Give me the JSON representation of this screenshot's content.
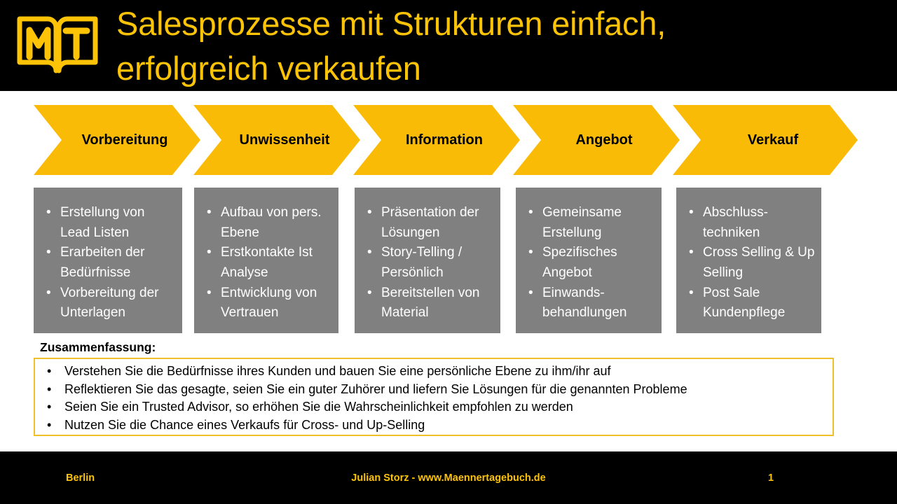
{
  "header": {
    "logo_icon": "open-book-mt-logo",
    "logo_letters": "MT",
    "title": "Salesprozesse mit Strukturen einfach,\nerfolgreich verkaufen"
  },
  "colors": {
    "brand_yellow": "#FABB07",
    "title_gold": "#FDC307",
    "box_gray": "#808080",
    "summary_border": "#EFC028",
    "bar_black": "#000000"
  },
  "process": {
    "steps": [
      {
        "label": "Vorbereitung"
      },
      {
        "label": "Unwissenheit"
      },
      {
        "label": "Information"
      },
      {
        "label": "Angebot"
      },
      {
        "label": "Verkauf"
      }
    ]
  },
  "detail_boxes": [
    {
      "step": "Vorbereitung",
      "items": [
        "Erstellung von Lead Listen",
        "Erarbeiten der Bedürfnisse",
        "Vorbereitung der Unterlagen"
      ]
    },
    {
      "step": "Unwissenheit",
      "items": [
        "Aufbau von pers. Ebene",
        "Erstkontakte Ist Analyse",
        "Entwicklung von Vertrauen"
      ]
    },
    {
      "step": "Information",
      "items": [
        "Präsentation der Lösungen",
        "Story-Telling / Persönlich",
        "Bereitstellen von Material"
      ]
    },
    {
      "step": "Angebot",
      "items": [
        "Gemeinsame Erstellung",
        "Spezifisches Angebot",
        "Einwands-behandlungen"
      ]
    },
    {
      "step": "Verkauf",
      "items": [
        "Abschluss-techniken",
        "Cross Selling & Up Selling",
        "Post Sale Kundenpflege"
      ]
    }
  ],
  "summary": {
    "label": "Zusammenfassung:",
    "bullet_glyph": "•",
    "items": [
      "Verstehen Sie die Bedürfnisse ihres Kunden und bauen Sie eine persönliche Ebene zu ihm/ihr auf",
      "Reflektieren Sie das gesagte, seien Sie ein guter Zuhörer und liefern Sie Lösungen für die genannten Probleme",
      "Seien Sie ein Trusted Advisor, so erhöhen Sie die Wahrscheinlichkeit empfohlen zu werden",
      "Nutzen Sie die Chance eines Verkaufs für Cross- und Up-Selling"
    ]
  },
  "footer": {
    "left": "Berlin",
    "center": "Julian Storz - www.Maennertagebuch.de",
    "page_number": "1"
  }
}
